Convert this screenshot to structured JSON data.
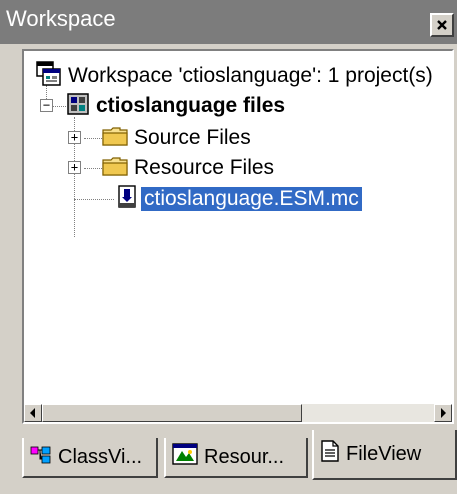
{
  "window": {
    "title": "Workspace",
    "close_glyph": "×"
  },
  "tree": {
    "root": {
      "label": "Workspace 'ctioslanguage': 1 project(s)",
      "icon": "workspace-icon"
    },
    "project": {
      "label": "ctioslanguage files",
      "icon": "project-icon",
      "expander": "−"
    },
    "items": [
      {
        "label": "Source Files",
        "icon": "folder-icon",
        "expander": "+"
      },
      {
        "label": "Resource Files",
        "icon": "folder-icon",
        "expander": "+"
      },
      {
        "label": "ctioslanguage.ESM.mc",
        "icon": "file-icon",
        "selected": true
      }
    ]
  },
  "tabs": [
    {
      "label": "ClassVi...",
      "icon": "class-view-icon",
      "active": false
    },
    {
      "label": "Resour...",
      "icon": "resource-view-icon",
      "active": false
    },
    {
      "label": "FileView",
      "icon": "file-view-icon",
      "active": true
    }
  ],
  "colors": {
    "titlebar": "#7c7c7c",
    "selection": "#316ac5",
    "panel": "#d4d0c8"
  }
}
